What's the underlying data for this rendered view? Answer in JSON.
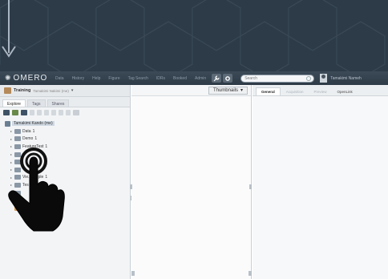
{
  "app": {
    "logo_text": "OMERO",
    "nav": [
      "Data",
      "History",
      "Help",
      "Figure",
      "Tag Search",
      "IDRs",
      "Booked",
      "Admin"
    ],
    "search_placeholder": "Search",
    "user_name": "Tamakimi Nameh"
  },
  "left_panel": {
    "group_name": "Training",
    "group_user": "Tamakimi Nakimi (me)",
    "tabs": [
      "Explore",
      "Tags",
      "Shares"
    ],
    "active_tab": "Explore",
    "tree_root": "Tamakimi Kando (me)",
    "tree_items": [
      {
        "label": "Data",
        "count": "1",
        "kind": "project"
      },
      {
        "label": "Demo",
        "count": "1",
        "kind": "project"
      },
      {
        "label": "FeatureTest",
        "count": "1",
        "kind": "project"
      },
      {
        "label": "",
        "count": "",
        "kind": "project"
      },
      {
        "label": "",
        "count": "",
        "kind": "project"
      },
      {
        "label": "",
        "count": "",
        "kind": "project"
      },
      {
        "label": "Vie... ample",
        "count": "1",
        "kind": "project"
      },
      {
        "label": "Tes",
        "count": "",
        "kind": "project"
      },
      {
        "label": "",
        "count": "",
        "kind": "project"
      },
      {
        "label": "",
        "count": "",
        "kind": "dataset-green"
      },
      {
        "label": "",
        "count": "",
        "kind": "dataset-orange"
      }
    ]
  },
  "center_panel": {
    "view_mode": "Thumbnails"
  },
  "right_panel": {
    "tabs": [
      "General",
      "Acquisition",
      "Preview",
      "OpenLink"
    ],
    "active_tab": "General"
  },
  "colors": {
    "topbar": "#33404c",
    "background": "#2d3b48",
    "accent": "#3f5366"
  },
  "icons": [
    "down-arrow-icon",
    "tap-hand-icon",
    "omero-logo-icon",
    "search-icon",
    "user-avatar-icon"
  ]
}
